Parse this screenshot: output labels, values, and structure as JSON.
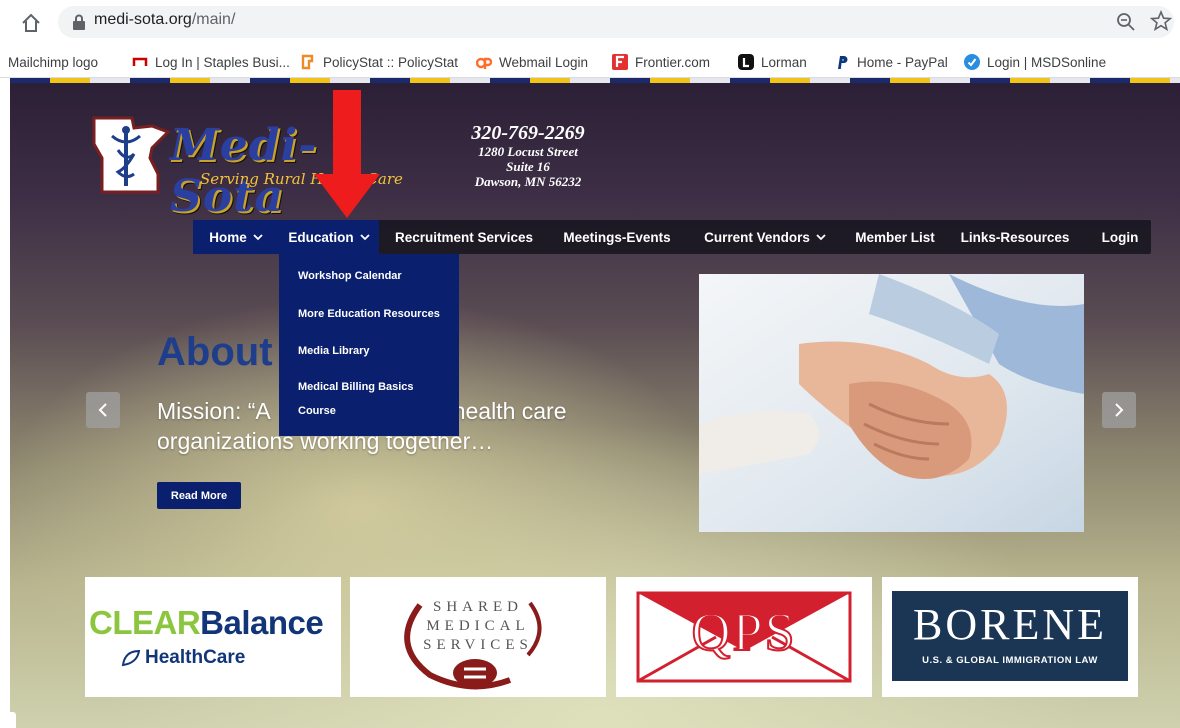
{
  "browser": {
    "url_host": "medi-sota.org",
    "url_path": "/main/",
    "bookmarks": [
      {
        "label": "Mailchimp logo",
        "icon": "none"
      },
      {
        "label": "Log In | Staples Busi...",
        "icon": "staples-icon"
      },
      {
        "label": "PolicyStat :: PolicyStat",
        "icon": "policystat-icon"
      },
      {
        "label": "Webmail Login",
        "icon": "cpanel-icon"
      },
      {
        "label": "Frontier.com",
        "icon": "frontier-icon"
      },
      {
        "label": "Lorman",
        "icon": "lorman-icon"
      },
      {
        "label": "Home - PayPal",
        "icon": "paypal-icon"
      },
      {
        "label": "Login | MSDSonline",
        "icon": "msds-icon"
      }
    ]
  },
  "header": {
    "logo_text": "Medi-Sota",
    "logo_tagline": "Serving Rural Health Care",
    "phone": "320-769-2269",
    "address_line1": "1280 Locust Street",
    "address_line2": "Suite 16",
    "address_line3": "Dawson, MN 56232"
  },
  "nav": {
    "items": [
      {
        "label": "Home",
        "has_dropdown": true
      },
      {
        "label": "Education",
        "has_dropdown": true,
        "active": true
      },
      {
        "label": "Recruitment Services",
        "has_dropdown": false
      },
      {
        "label": "Meetings-Events",
        "has_dropdown": false
      },
      {
        "label": "Current Vendors",
        "has_dropdown": true
      },
      {
        "label": "Member List",
        "has_dropdown": false
      },
      {
        "label": "Links-Resources",
        "has_dropdown": false
      },
      {
        "label": "Login",
        "has_dropdown": false
      }
    ],
    "education_dropdown": [
      "Workshop Calendar",
      "More Education Resources",
      "Media Library",
      "Medical Billing Basics",
      "Course"
    ]
  },
  "hero": {
    "title": "About",
    "mission_line1_a": "Mission: “A",
    "mission_line1_b": "ral health care",
    "mission_line2": "organizations working together…",
    "read_more": "Read More"
  },
  "sponsors": {
    "clear_a": "CLEAR",
    "clear_b": "Balance",
    "clear_health": "HealthCare",
    "shared_1": "SHARED",
    "shared_2": "MEDICAL",
    "shared_3": "SERVICES",
    "qps": "QPS",
    "borene": "BORENE",
    "borene_sub": "U.S. & GLOBAL IMMIGRATION LAW"
  },
  "colors": {
    "nav_active": "#0a1f6e",
    "accent_red": "#ee1c1c",
    "about_blue": "#1e3e8c"
  }
}
